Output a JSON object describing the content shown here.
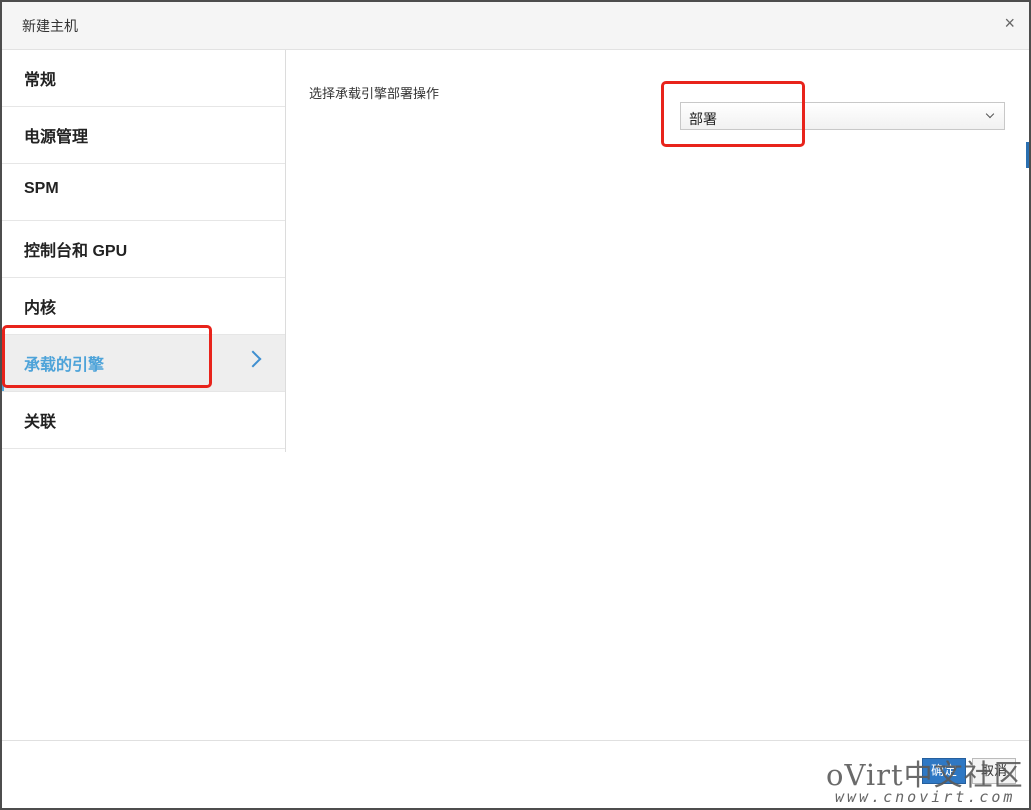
{
  "dialog": {
    "title": "新建主机",
    "close_label": "×"
  },
  "sidebar": {
    "items": [
      {
        "label": "常规"
      },
      {
        "label": "电源管理"
      },
      {
        "label": "SPM"
      },
      {
        "label": "控制台和 GPU"
      },
      {
        "label": "内核"
      },
      {
        "label": "承载的引擎",
        "active": true
      },
      {
        "label": "关联"
      }
    ]
  },
  "hosted_engine": {
    "deploy_action_label": "选择承载引擎部署操作",
    "deploy_action_value": "部署"
  },
  "footer": {
    "ok_label": "确定",
    "cancel_label": "取消"
  },
  "watermark": {
    "line1": "oVirt中文社区",
    "line2": "www.cnovirt.com"
  },
  "colors": {
    "accent": "#4da3d9",
    "highlight": "#e8231b",
    "primary_button": "#2f78c4"
  }
}
